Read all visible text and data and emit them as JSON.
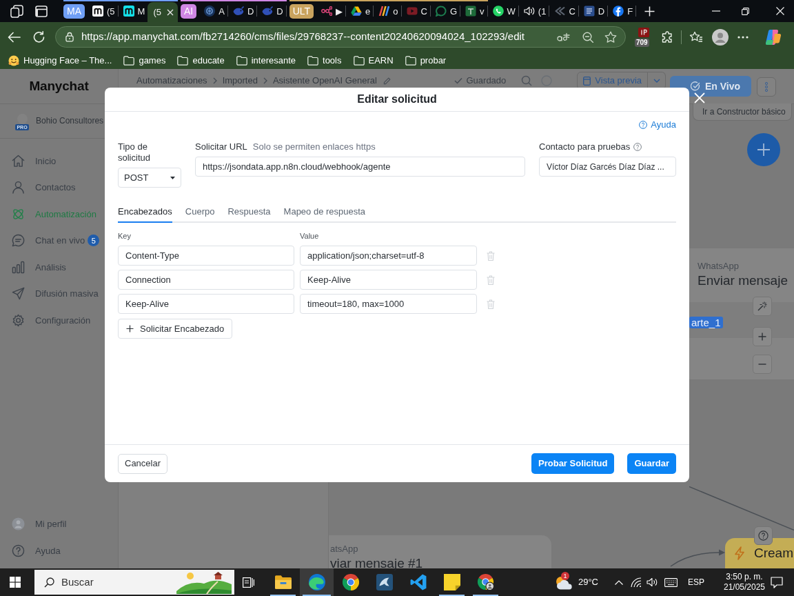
{
  "browser": {
    "tab_strip": [
      {
        "kind": "group",
        "name": "MA",
        "color": "#6f9ff5",
        "tabs": [
          {
            "title": "(5",
            "selected": false
          },
          {
            "title": "M",
            "selected": false
          },
          {
            "title": "(5",
            "selected": true
          }
        ]
      },
      {
        "kind": "group",
        "name": "AI",
        "color": "#cf87e4",
        "tabs": [
          {
            "title": "A",
            "selected": false
          },
          {
            "title": "D",
            "selected": false
          },
          {
            "title": "D",
            "selected": false
          }
        ]
      },
      {
        "kind": "group",
        "name": "ULT",
        "color": "#c9a35e",
        "tabs": [
          {
            "title": "▶",
            "selected": false
          },
          {
            "title": "e",
            "selected": false
          },
          {
            "title": "o",
            "selected": false
          },
          {
            "title": "C",
            "selected": false
          },
          {
            "title": "G",
            "selected": false
          },
          {
            "title": "v",
            "selected": false
          }
        ]
      },
      {
        "kind": "tab",
        "title": "W",
        "selected": false
      },
      {
        "kind": "tab",
        "title": "(1",
        "selected": false
      },
      {
        "kind": "tab",
        "title": "C",
        "selected": false
      },
      {
        "kind": "tab",
        "title": "D",
        "selected": false
      },
      {
        "kind": "tab",
        "title": "F",
        "selected": false
      }
    ],
    "address_bar": {
      "url": "https://app.manychat.com/fb2714260/cms/files/29768237--content20240620094024_102293/edit",
      "extension_badge": "709"
    },
    "bookmarks": [
      {
        "label": "Hugging Face – The..."
      },
      {
        "label": "games"
      },
      {
        "label": "educate"
      },
      {
        "label": "interesante"
      },
      {
        "label": "tools"
      },
      {
        "label": "EARN"
      },
      {
        "label": "probar"
      }
    ]
  },
  "app": {
    "sidebar": {
      "logo": "Manychat",
      "account": {
        "name": "Bohio Consultores",
        "plan": "PRO"
      },
      "items": [
        {
          "label": "Inicio",
          "selected": false
        },
        {
          "label": "Contactos",
          "selected": false
        },
        {
          "label": "Automatización",
          "selected": true
        },
        {
          "label": "Chat en vivo",
          "selected": false,
          "count": "5"
        },
        {
          "label": "Análisis",
          "selected": false
        },
        {
          "label": "Difusión masiva",
          "selected": false
        },
        {
          "label": "Configuración",
          "selected": false
        }
      ],
      "footer": [
        {
          "label": "Mi perfil"
        },
        {
          "label": "Ayuda"
        }
      ]
    },
    "header": {
      "breadcrumb": [
        "Automatizaciones",
        "Imported",
        "Asistente OpenAI General"
      ],
      "save_status": "Guardado",
      "preview_button": "Vista previa",
      "live_button": "En Vivo",
      "basic_builder_button": "Ir a Constructor básico"
    },
    "canvas": {
      "nodes": [
        {
          "kind": "message",
          "channel": "WhatsApp",
          "title": "Enviar mensaje",
          "chip": "arte_1"
        },
        {
          "kind": "message",
          "channel": "atsApp",
          "title": "viar mensaje #1"
        },
        {
          "kind": "trigger",
          "title": "Cream"
        }
      ]
    }
  },
  "dialog": {
    "title": "Editar solicitud",
    "help_link": "Ayuda",
    "request_type": {
      "label": "Tipo de solicitud",
      "value": "POST"
    },
    "url": {
      "label": "Solicitar URL",
      "hint": "Solo se permiten enlaces https",
      "value": "https://jsondata.app.n8n.cloud/webhook/agente"
    },
    "test_contact": {
      "label": "Contacto para pruebas",
      "value": "Víctor Díaz Garcés Díaz Díaz ..."
    },
    "tabs": [
      {
        "label": "Encabezados",
        "selected": true
      },
      {
        "label": "Cuerpo",
        "selected": false
      },
      {
        "label": "Respuesta",
        "selected": false
      },
      {
        "label": "Mapeo de respuesta",
        "selected": false
      }
    ],
    "headers": {
      "columns": [
        "Key",
        "Value"
      ],
      "rows": [
        {
          "key": "Content-Type",
          "value": "application/json;charset=utf-8"
        },
        {
          "key": "Connection",
          "value": "Keep-Alive"
        },
        {
          "key": "Keep-Alive",
          "value": "timeout=180, max=1000"
        }
      ],
      "add_button": "Solicitar Encabezado"
    },
    "buttons": {
      "cancel": "Cancelar",
      "test": "Probar Solicitud",
      "save": "Guardar"
    }
  },
  "taskbar": {
    "search": {
      "placeholder": "Buscar"
    },
    "apps": [
      {
        "running": true,
        "selected": false
      },
      {
        "running": true,
        "selected": true
      },
      {
        "running": false,
        "selected": false
      },
      {
        "running": false,
        "selected": false
      },
      {
        "running": false,
        "selected": false
      },
      {
        "running": true,
        "selected": false
      },
      {
        "running": true,
        "selected": false
      }
    ],
    "weather": {
      "temperature": "29°C",
      "alert_count": "1"
    },
    "language": "ESP",
    "time": "3:50 p. m.",
    "date": "21/05/2025"
  }
}
